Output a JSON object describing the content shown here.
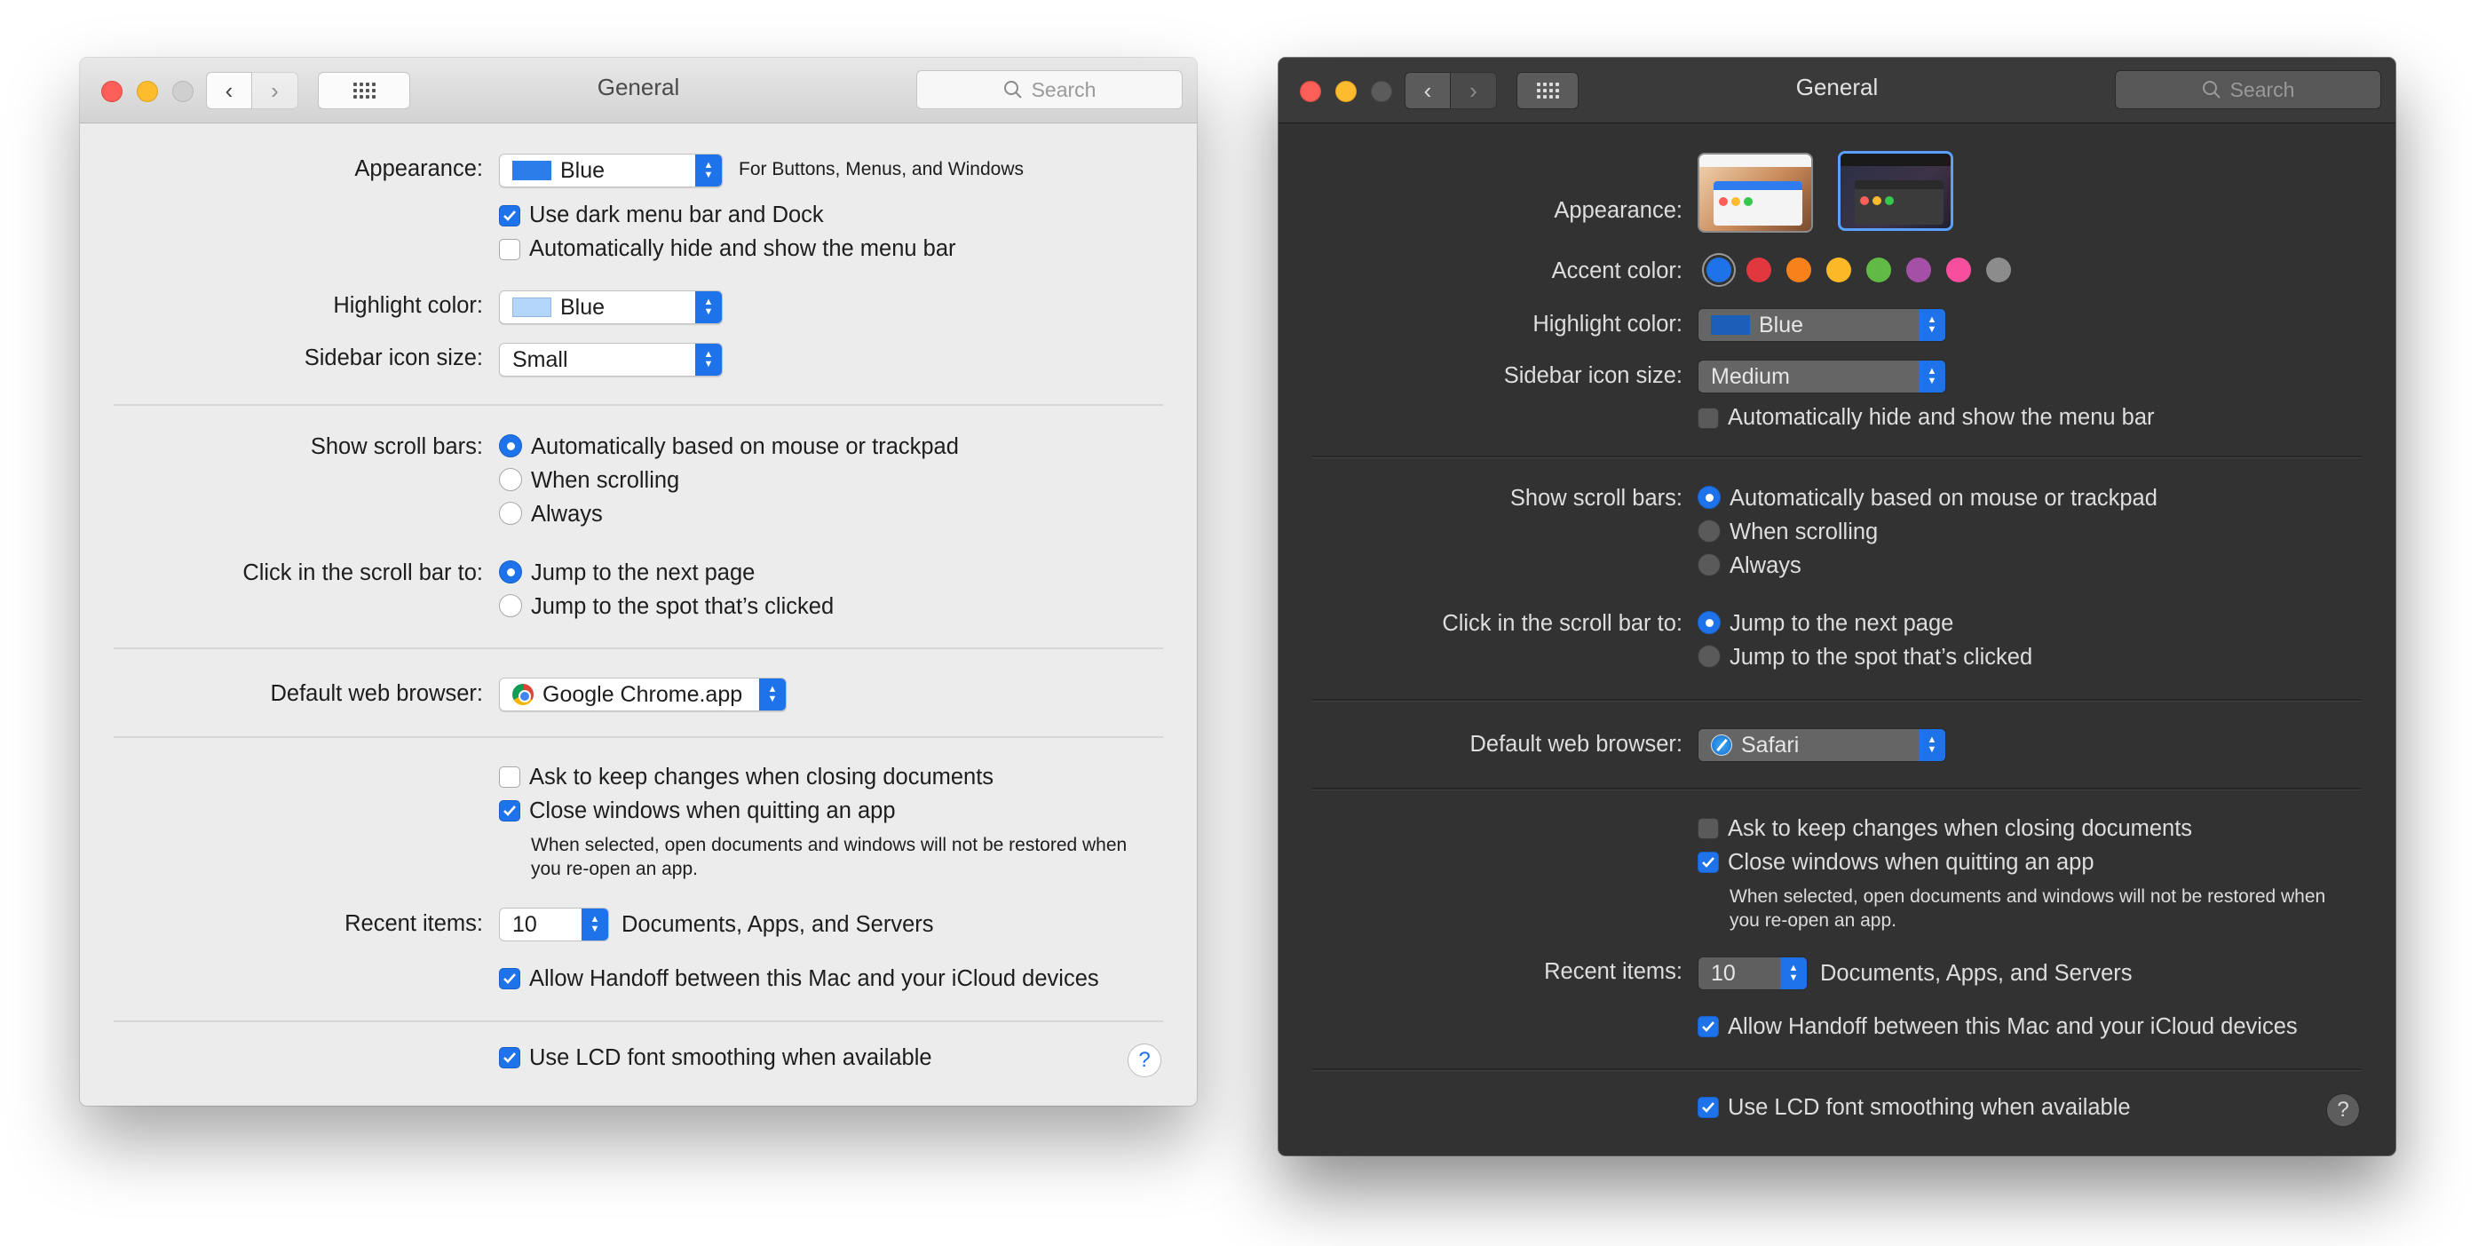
{
  "light": {
    "title": "General",
    "search_placeholder": "Search",
    "appearance_label": "Appearance:",
    "appearance_value": "Blue",
    "appearance_note": "For Buttons, Menus, and Windows",
    "dark_menu_label": "Use dark menu bar and Dock",
    "auto_hide_label": "Automatically hide and show the menu bar",
    "highlight_label": "Highlight color:",
    "highlight_value": "Blue",
    "sidebar_label": "Sidebar icon size:",
    "sidebar_value": "Small",
    "scroll_label": "Show scroll bars:",
    "scroll_options": [
      "Automatically based on mouse or trackpad",
      "When scrolling",
      "Always"
    ],
    "click_label": "Click in the scroll bar to:",
    "click_options": [
      "Jump to the next page",
      "Jump to the spot that’s clicked"
    ],
    "browser_label": "Default web browser:",
    "browser_value": "Google Chrome.app",
    "ask_keep_label": "Ask to keep changes when closing documents",
    "close_windows_label": "Close windows when quitting an app",
    "close_windows_note": "When selected, open documents and windows will not be restored when you re-open an app.",
    "recent_label": "Recent items:",
    "recent_value": "10",
    "recent_note": "Documents, Apps, and Servers",
    "handoff_label": "Allow Handoff between this Mac and your iCloud devices",
    "lcd_label": "Use LCD font smoothing when available",
    "help": "?",
    "state": {
      "dark_menu": true,
      "auto_hide": false,
      "scroll_selected": 0,
      "click_selected": 0,
      "ask_keep": false,
      "close_windows": true,
      "handoff": true,
      "lcd": true
    }
  },
  "dark": {
    "title": "General",
    "search_placeholder": "Search",
    "appearance_label": "Appearance:",
    "accent_label": "Accent color:",
    "accent_colors": [
      "#1f73ea",
      "#e0383e",
      "#f7821b",
      "#fcb827",
      "#62ba46",
      "#a550a7",
      "#f74f9e",
      "#8c8c8c"
    ],
    "highlight_label": "Highlight color:",
    "highlight_value": "Blue",
    "sidebar_label": "Sidebar icon size:",
    "sidebar_value": "Medium",
    "auto_hide_label": "Automatically hide and show the menu bar",
    "scroll_label": "Show scroll bars:",
    "scroll_options": [
      "Automatically based on mouse or trackpad",
      "When scrolling",
      "Always"
    ],
    "click_label": "Click in the scroll bar to:",
    "click_options": [
      "Jump to the next page",
      "Jump to the spot that’s clicked"
    ],
    "browser_label": "Default web browser:",
    "browser_value": "Safari",
    "ask_keep_label": "Ask to keep changes when closing documents",
    "close_windows_label": "Close windows when quitting an app",
    "close_windows_note": "When selected, open documents and windows will not be restored when you re-open an app.",
    "recent_label": "Recent items:",
    "recent_value": "10",
    "recent_note": "Documents, Apps, and Servers",
    "handoff_label": "Allow Handoff between this Mac and your iCloud devices",
    "lcd_label": "Use LCD font smoothing when available",
    "help": "?"
  },
  "icons": {
    "back": "chevron-left-icon",
    "forward": "chevron-right-icon",
    "grid": "show-all-grid-icon",
    "search": "search-icon",
    "browser_light": "chrome-icon",
    "browser_dark": "safari-icon"
  }
}
